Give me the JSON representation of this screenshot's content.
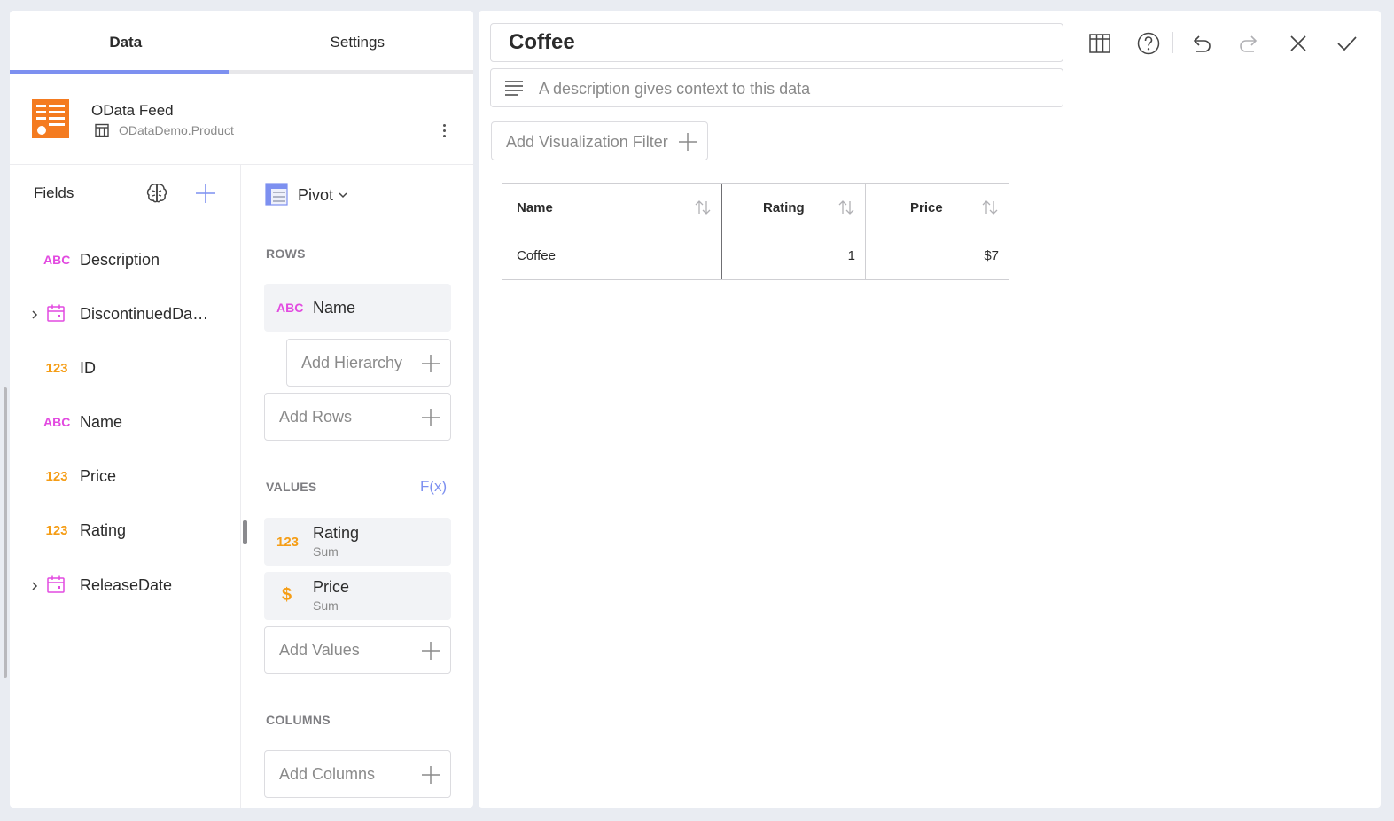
{
  "tabs": {
    "data": "Data",
    "settings": "Settings"
  },
  "source": {
    "title": "OData Feed",
    "subtitle": "ODataDemo.Product",
    "icon": "odata-feed-icon",
    "accent": "#f47b20"
  },
  "fields": {
    "title": "Fields",
    "items": [
      {
        "type": "ABC",
        "label": "Description"
      },
      {
        "type": "date",
        "label": "DiscontinuedDa…",
        "expandable": true
      },
      {
        "type": "123",
        "label": "ID"
      },
      {
        "type": "ABC",
        "label": "Name"
      },
      {
        "type": "123",
        "label": "Price"
      },
      {
        "type": "123",
        "label": "Rating"
      },
      {
        "type": "date",
        "label": "ReleaseDate",
        "expandable": true
      }
    ]
  },
  "pivot": {
    "visualization": "Pivot",
    "rows_title": "ROWS",
    "rows_chip": {
      "type": "ABC",
      "name": "Name"
    },
    "add_hierarchy": "Add Hierarchy",
    "add_rows": "Add Rows",
    "values_title": "VALUES",
    "fx": "F(x)",
    "values": [
      {
        "type": "123",
        "name": "Rating",
        "agg": "Sum"
      },
      {
        "type": "$",
        "name": "Price",
        "agg": "Sum"
      }
    ],
    "add_values": "Add Values",
    "columns_title": "COLUMNS",
    "add_columns": "Add Columns"
  },
  "editor": {
    "title": "Coffee",
    "description_placeholder": "A description gives context to this data",
    "add_filter": "Add Visualization Filter",
    "toolbar": [
      "grid-view-icon",
      "help-icon",
      "undo-icon",
      "redo-icon",
      "close-icon",
      "check-icon"
    ]
  },
  "table": {
    "headers": [
      "Name",
      "Rating",
      "Price"
    ],
    "rows": [
      [
        "Coffee",
        "1",
        "$7"
      ]
    ]
  },
  "colors": {
    "accent": "#7d90f0",
    "text_type": "#e24ae0",
    "number_type": "#f59d16"
  }
}
